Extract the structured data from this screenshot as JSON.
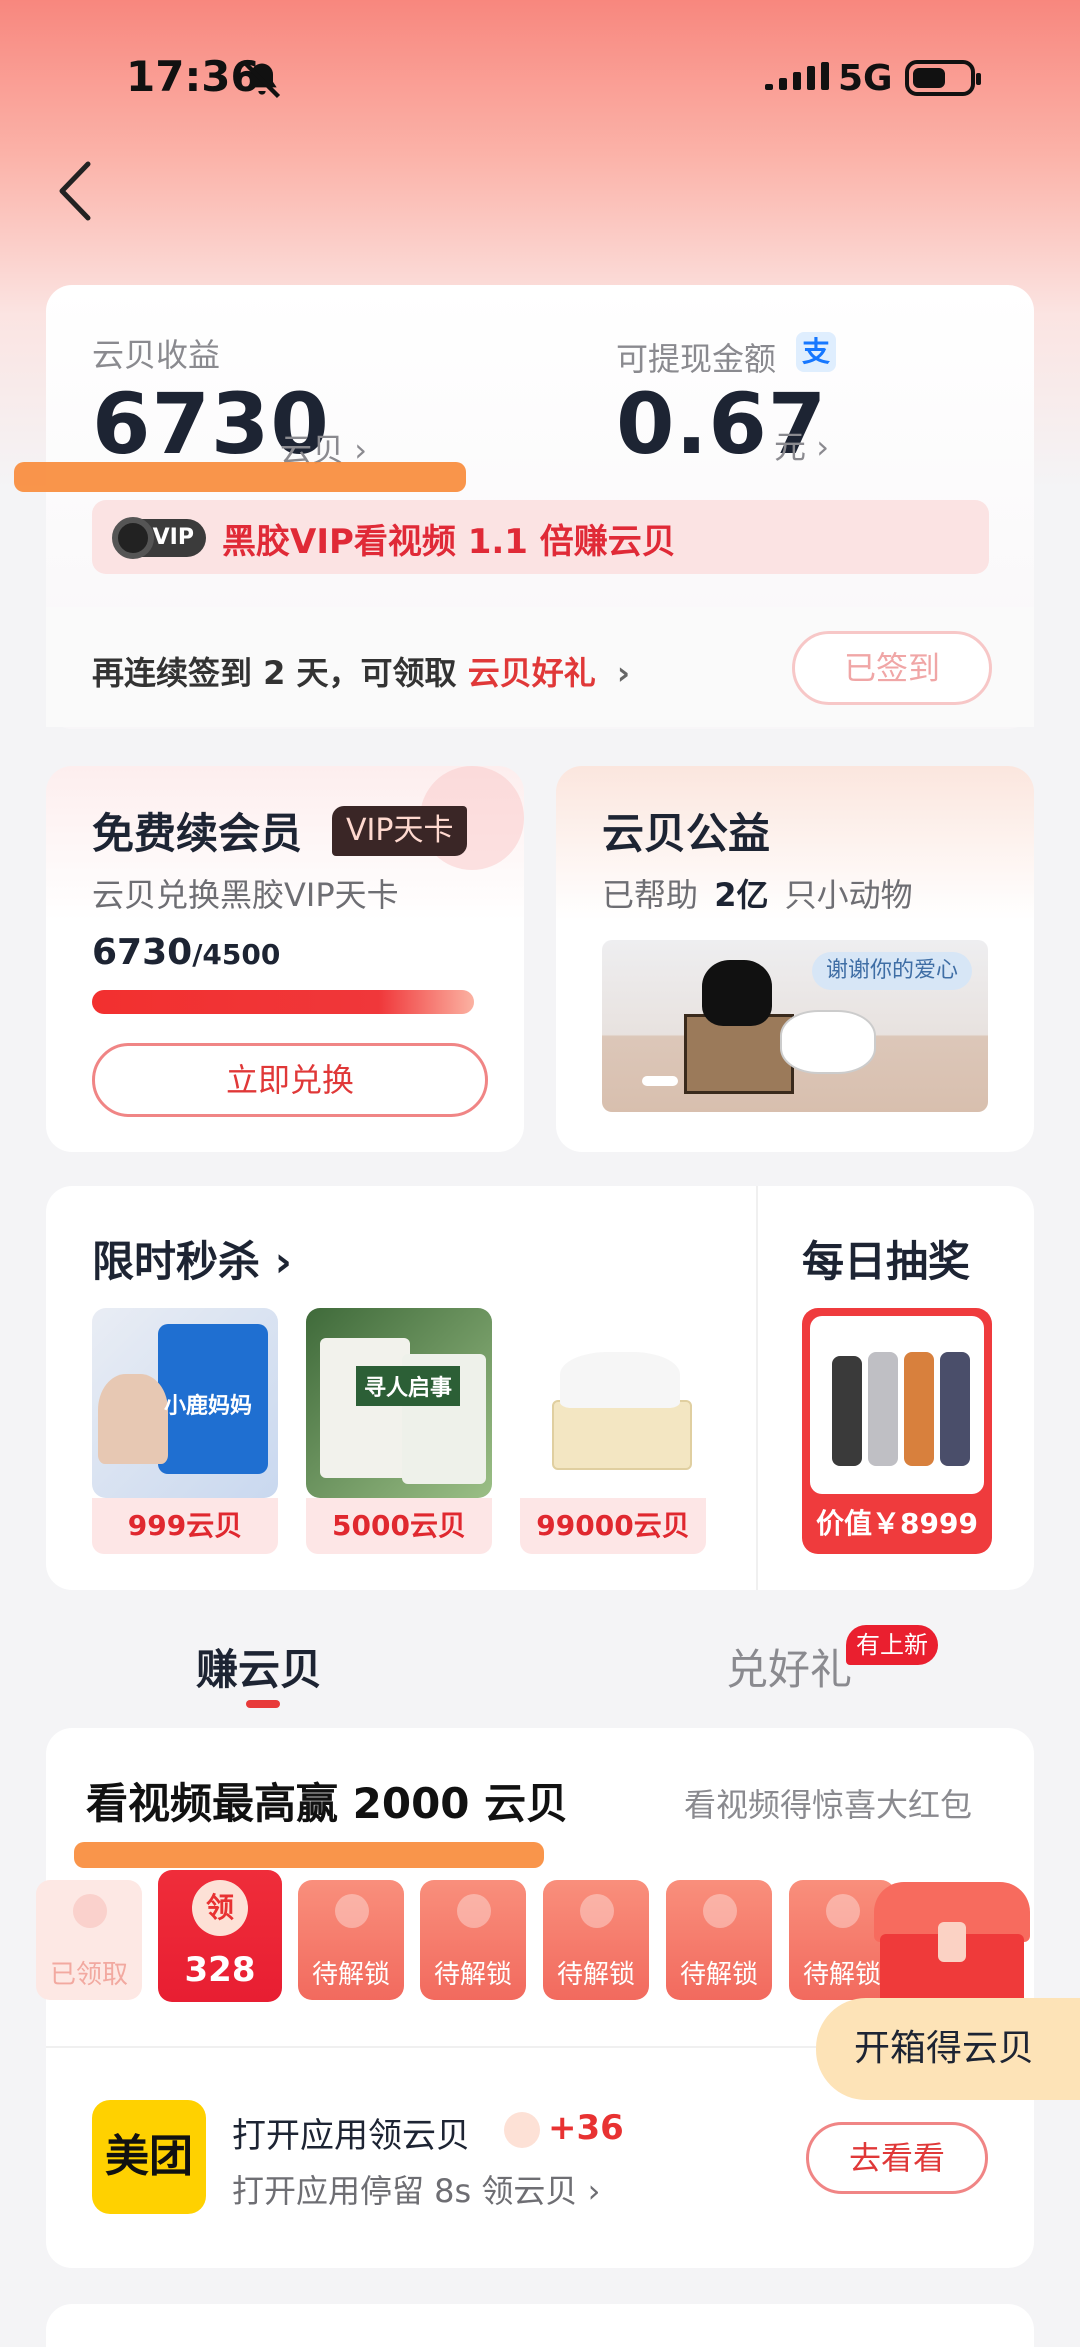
{
  "status_bar": {
    "time": "17:36",
    "network": "5G"
  },
  "earnings": {
    "label": "云贝收益",
    "value": "6730",
    "unit": "云贝",
    "withdraw_label": "可提现金额",
    "withdraw_value": "0.67",
    "withdraw_unit": "元",
    "vip_badge": "VIP",
    "vip_promo": "黑胶VIP看视频 1.1 倍赚云贝"
  },
  "signin": {
    "text_prefix": "再连续签到 2 天，可领取",
    "text_link": "云贝好礼",
    "button": "已签到"
  },
  "free_vip": {
    "title": "免费续会员",
    "tag": "VIP天卡",
    "subtitle": "云贝兑换黑胶VIP天卡",
    "current": "6730",
    "target": "/4500",
    "progress": 1.0,
    "button": "立即兑换"
  },
  "charity": {
    "title": "云贝公益",
    "helped_prefix": "已帮助",
    "helped_count": "2亿",
    "helped_suffix": "只小动物",
    "bubble": "谢谢你的爱心"
  },
  "flash_sale": {
    "title": "限时秒杀",
    "items": [
      {
        "price": "999云贝",
        "brand": "小鹿妈妈"
      },
      {
        "price": "5000云贝",
        "brand": "寻人启事"
      },
      {
        "price": "99000云贝",
        "brand": "纸巾"
      }
    ]
  },
  "lottery": {
    "title": "每日抽奖",
    "price": "价值￥8999"
  },
  "tabs": {
    "earn": "赚云贝",
    "redeem": "兑好礼",
    "new_badge": "有上新"
  },
  "video_task": {
    "title": "看视频最高赢 2000 云贝",
    "subtitle": "看视频得惊喜大红包",
    "claimed": "已领取",
    "current_label": "领",
    "current_value": "328",
    "locked": [
      "待解锁",
      "待解锁",
      "待解锁",
      "待解锁",
      "待解锁"
    ]
  },
  "chest": {
    "label": "开箱得云贝"
  },
  "app_task": {
    "logo": "美团",
    "title": "打开应用领云贝",
    "reward": "+36",
    "subtitle": "打开应用停留 8s 领云贝",
    "button": "去看看"
  },
  "colors": {
    "accent": "#e03838",
    "brand_dark": "#1d2433",
    "highlight": "#f98c3c"
  }
}
